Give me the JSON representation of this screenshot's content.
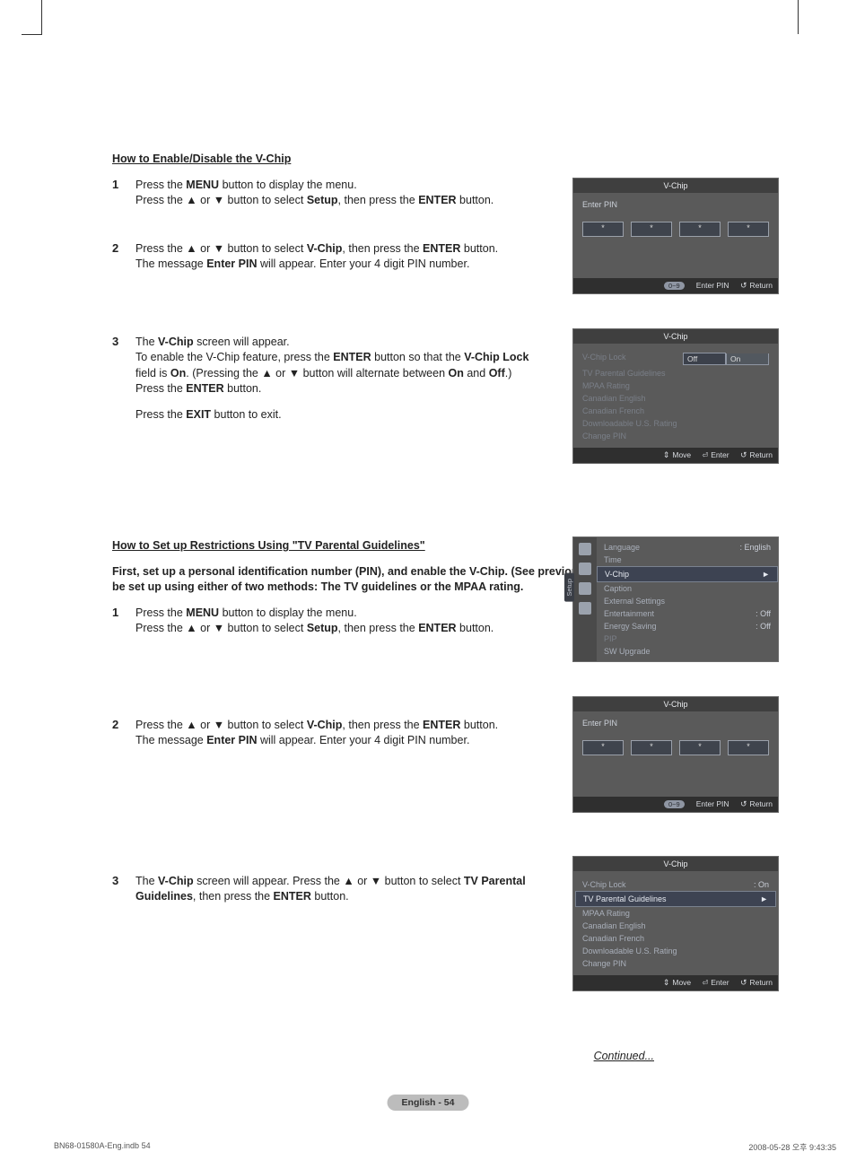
{
  "section1": {
    "title": "How to Enable/Disable the V-Chip",
    "steps": [
      {
        "num": "1",
        "html": "Press the <b>MENU</b> button to display the menu.<br>Press the ▲ or ▼ button to select <b>Setup</b>, then press the <b>ENTER</b> button."
      },
      {
        "num": "2",
        "html": "Press the ▲ or ▼ button to select <b>V-Chip</b>, then press the <b>ENTER</b> button.<br>The message <b>Enter PIN</b> will appear. Enter your 4 digit PIN number."
      },
      {
        "num": "3",
        "html": "The <b>V-Chip</b> screen will appear.<br>To enable the V-Chip feature, press the <b>ENTER</b> button so that the <b>V-Chip Lock</b> field is <b>On</b>. (Pressing the ▲ or ▼ button will alternate between <b>On</b> and <b>Off</b>.)<br>Press the <b>ENTER</b> button.",
        "after": "Press the <b>EXIT</b> button to exit."
      }
    ]
  },
  "section2": {
    "title": "How to Set up Restrictions Using \"TV Parental Guidelines\"",
    "intro": "First, set up a personal identification number (PIN), and enable the V-Chip. (See previous section.) Parental restrictions can be set up using either of two methods: The TV guidelines or the MPAA rating.",
    "steps": [
      {
        "num": "1",
        "html": "Press the <b>MENU</b> button to display the menu.<br>Press the ▲ or ▼ button to select <b>Setup</b>, then press the <b>ENTER</b> button."
      },
      {
        "num": "2",
        "html": "Press the ▲ or ▼ button to select <b>V-Chip</b>, then press the <b>ENTER</b> button.<br>The message <b>Enter PIN</b> will appear. Enter your 4 digit PIN number."
      },
      {
        "num": "3",
        "html": "The <b>V-Chip</b> screen will appear. Press the ▲ or ▼ button to select <b>TV Parental Guidelines</b>, then press the <b>ENTER</b> button."
      }
    ]
  },
  "osd1": {
    "title": "V-Chip",
    "label": "Enter PIN",
    "pins": [
      "*",
      "*",
      "*",
      "*"
    ],
    "foot": {
      "key": "0~9",
      "hint": "Enter PIN",
      "ret": "Return"
    }
  },
  "osd2": {
    "title": "V-Chip",
    "rows": [
      {
        "label": "V-Chip Lock",
        "dropdown": [
          "Off",
          "On"
        ],
        "dis": true
      },
      {
        "label": "TV Parental Guidelines",
        "dis": true
      },
      {
        "label": "MPAA Rating",
        "dis": true
      },
      {
        "label": "Canadian English",
        "dis": true
      },
      {
        "label": "Canadian French",
        "dis": true
      },
      {
        "label": "Downloadable U.S. Rating",
        "dis": true
      },
      {
        "label": "Change PIN",
        "dis": true
      }
    ],
    "foot": {
      "move": "Move",
      "enter": "Enter",
      "ret": "Return"
    }
  },
  "osd3": {
    "tab": "Setup",
    "rows": [
      {
        "label": "Language",
        "value": ": English"
      },
      {
        "label": "Time",
        "value": ""
      },
      {
        "label": "V-Chip",
        "highlight": true,
        "arrow": "►"
      },
      {
        "label": "Caption"
      },
      {
        "label": "External Settings"
      },
      {
        "label": "Entertainment",
        "value": ": Off"
      },
      {
        "label": "Energy Saving",
        "value": ": Off"
      },
      {
        "label": "PIP",
        "dis": true
      },
      {
        "label": "SW Upgrade"
      }
    ]
  },
  "osd4": {
    "title": "V-Chip",
    "label": "Enter PIN",
    "pins": [
      "*",
      "*",
      "*",
      "*"
    ],
    "foot": {
      "key": "0~9",
      "hint": "Enter PIN",
      "ret": "Return"
    }
  },
  "osd5": {
    "title": "V-Chip",
    "rows": [
      {
        "label": "V-Chip Lock",
        "value": ": On"
      },
      {
        "label": "TV Parental Guidelines",
        "highlight": true,
        "arrow": "►"
      },
      {
        "label": "MPAA Rating"
      },
      {
        "label": "Canadian English"
      },
      {
        "label": "Canadian French"
      },
      {
        "label": "Downloadable U.S. Rating"
      },
      {
        "label": "Change PIN"
      }
    ],
    "foot": {
      "move": "Move",
      "enter": "Enter",
      "ret": "Return"
    }
  },
  "continued": "Continued...",
  "pagebadge": "English - 54",
  "footer": {
    "left": "BN68-01580A-Eng.indb   54",
    "right": "2008-05-28   오후 9:43:35"
  }
}
